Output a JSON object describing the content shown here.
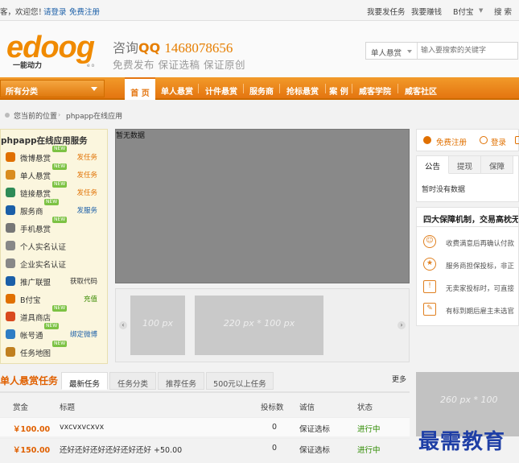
{
  "topbar": {
    "welcome": "客，欢迎您！",
    "login": "请登录",
    "register": "免费注册",
    "links": [
      "我要发任务",
      "我要赚钱",
      "B付宝",
      "搜 索"
    ]
  },
  "header": {
    "logo_main": "edoog",
    "logo_g": "g",
    "logo_sub": "一能动力",
    "logo_tm": "e o",
    "qq_prefix": "咨询",
    "qq_label": "QQ",
    "qq_number": "1468078656",
    "slogan": "免费发布  保证选稿  保证原创",
    "search_select": "单人悬赏",
    "search_placeholder": "输入要搜索的关键字"
  },
  "nav": {
    "all_categories": "所有分类",
    "items": [
      "首 页",
      "单人悬赏",
      "计件悬赏",
      "服务商",
      "抢标悬赏",
      "案 例",
      "威客学院",
      "威客社区"
    ]
  },
  "breadcrumb": {
    "current_label": "您当前的位置",
    "path": "phpapp在线应用"
  },
  "services": {
    "title": "phpapp在线应用服务",
    "items": [
      {
        "label": "微博悬赏",
        "action": "发任务",
        "new": true
      },
      {
        "label": "单人悬赏",
        "action": "发任务",
        "new": true
      },
      {
        "label": "链接悬赏",
        "action": "发任务",
        "new": true
      },
      {
        "label": "服务商",
        "action": "发服务",
        "new": true
      },
      {
        "label": "手机悬赏",
        "action": "",
        "new": true
      },
      {
        "label": "个人实名认证",
        "action": "",
        "new": false
      },
      {
        "label": "企业实名认证",
        "action": "",
        "new": false
      },
      {
        "label": "推广联盟",
        "action": "获取代码",
        "new": false
      },
      {
        "label": "B付宝",
        "action": "充值",
        "new": false
      },
      {
        "label": "道具商店",
        "action": "",
        "new": true
      },
      {
        "label": "帐号通",
        "action": "绑定微博",
        "new": true
      },
      {
        "label": "任务地图",
        "action": "",
        "new": true
      }
    ],
    "new_tag": "NEW"
  },
  "slider": {
    "nodata": "暂无数据",
    "thumb1": "100 px",
    "thumb2": "220 px * 100 px"
  },
  "right": {
    "register": "免费注册",
    "login": "登录",
    "tabs": [
      "公告",
      "提现",
      "保障"
    ],
    "nodata": "暂时没有数据",
    "guarantee_title": "四大保障机制，交易高枕无忧",
    "guarantee_items": [
      "收费满意后再确认付款",
      "服务商担保投标，非正",
      "无卖家投标时，可直接",
      "有标到期后雇主未选官"
    ],
    "ad": "260 px * 100"
  },
  "tasks": {
    "title": "单人悬赏任务",
    "tabs": [
      "最新任务",
      "任务分类",
      "推荐任务",
      "500元以上任务"
    ],
    "more": "更多",
    "headers": [
      "赏金",
      "标题",
      "投标数",
      "诚信",
      "状态"
    ],
    "rows": [
      {
        "money": "￥100.00",
        "title": "vxcvxvcxvx",
        "bids": "0",
        "trust": "保证选标",
        "status": "进行中"
      },
      {
        "money": "￥150.00",
        "title": "还好还好还好还好还好还好 +50.00",
        "bids": "0",
        "trust": "保证选标",
        "status": "进行中"
      }
    ]
  },
  "watermark": "最需教育"
}
